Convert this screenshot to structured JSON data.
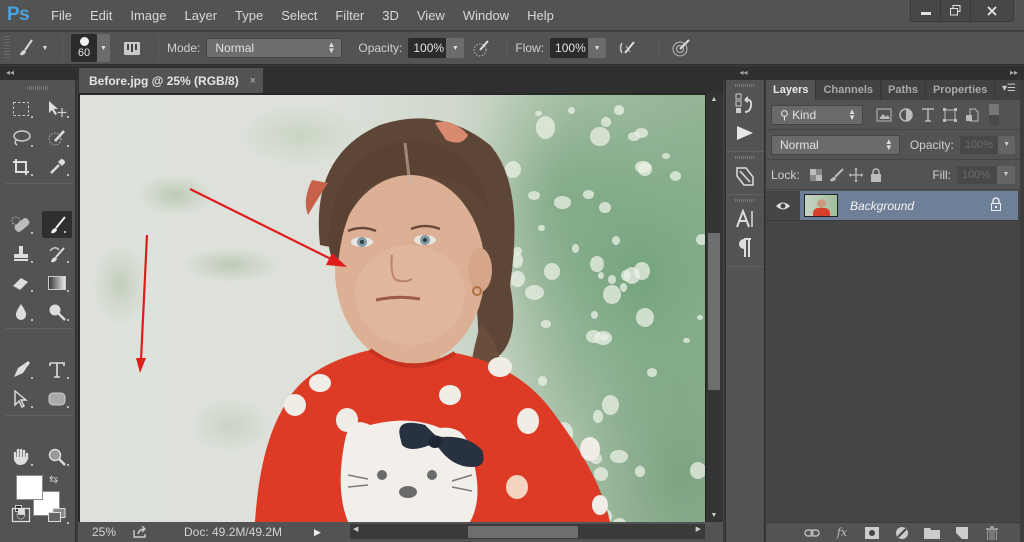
{
  "app": {
    "logo": "Ps",
    "menu": [
      "File",
      "Edit",
      "Image",
      "Layer",
      "Type",
      "Select",
      "Filter",
      "3D",
      "View",
      "Window",
      "Help"
    ],
    "window_controls": {
      "minimize": "minimize-icon",
      "restore": "restore-icon",
      "close": "close-icon"
    }
  },
  "options_bar": {
    "tool_icon": "brush-icon",
    "brush_size": "60",
    "mode_label": "Mode:",
    "mode_value": "Normal",
    "opacity_label": "Opacity:",
    "opacity_value": "100%",
    "flow_label": "Flow:",
    "flow_value": "100%"
  },
  "document": {
    "tab_title": "Before.jpg @ 25% (RGB/8)",
    "close_glyph": "×",
    "annotation_color": "#e01d1d"
  },
  "status_bar": {
    "zoom": "25%",
    "doc_size": "Doc: 49.2M/49.2M"
  },
  "tools": [
    "rectangular-marquee",
    "move",
    "lasso",
    "quick-selection",
    "crop",
    "eyedropper",
    "spot-healing-brush",
    "brush",
    "clone-stamp",
    "history-brush",
    "eraser",
    "gradient",
    "blur",
    "dodge",
    "pen",
    "type",
    "path-selection",
    "rectangle",
    "hand",
    "zoom"
  ],
  "colors": {
    "foreground": "#ffffff",
    "background": "#ffffff"
  },
  "middle_dock": [
    "history-icon",
    "actions-icon",
    "tool-presets-icon",
    "character-icon",
    "paragraph-icon"
  ],
  "layers_panel": {
    "tabs": [
      "Layers",
      "Channels",
      "Paths",
      "Properties"
    ],
    "active_tab": "Layers",
    "filter_label": "Kind",
    "blend_mode": "Normal",
    "opacity_label": "Opacity:",
    "opacity_value": "100%",
    "lock_label": "Lock:",
    "fill_label": "Fill:",
    "fill_value": "100%",
    "layers": [
      {
        "name": "Background",
        "visible": true,
        "locked": true,
        "selected": true
      }
    ],
    "selected_color": "#6e8097",
    "bottom_icons": [
      "link-layers-icon",
      "fx-icon",
      "add-mask-icon",
      "adjustment-layer-icon",
      "new-group-icon",
      "new-layer-icon",
      "delete-icon"
    ],
    "fx_label": "fx"
  }
}
